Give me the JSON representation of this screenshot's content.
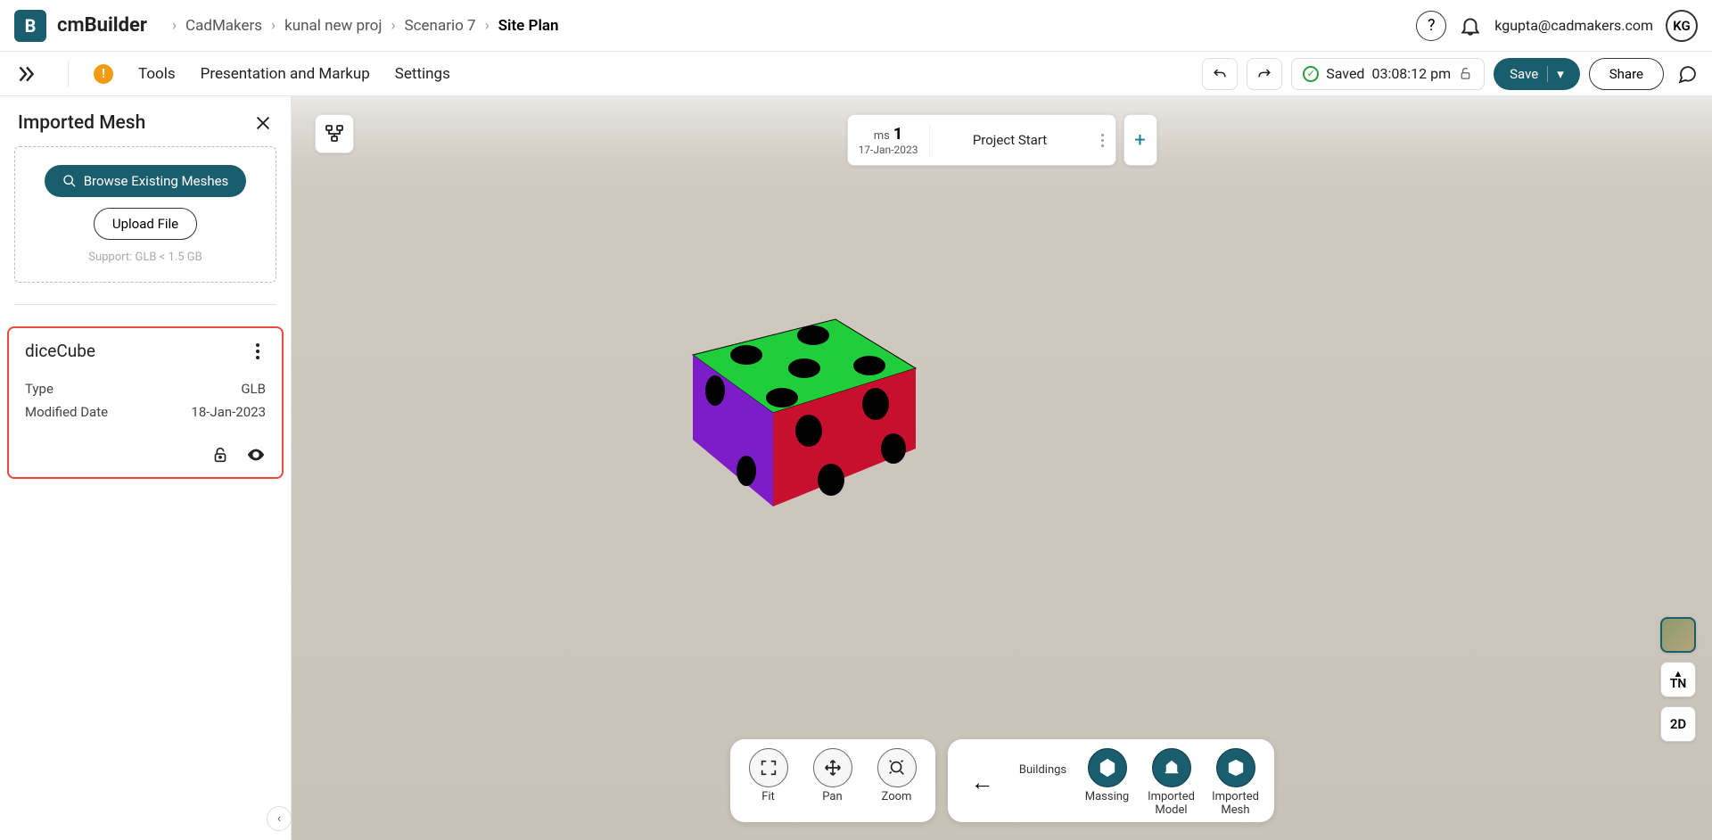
{
  "brand": {
    "prefix": "cm",
    "main": "Builder"
  },
  "breadcrumbs": [
    "CadMakers",
    "kunal new proj",
    "Scenario 7",
    "Site Plan"
  ],
  "user": {
    "email": "kgupta@cadmakers.com",
    "initials": "KG"
  },
  "menu": {
    "tools": "Tools",
    "presentation": "Presentation and Markup",
    "settings": "Settings"
  },
  "actions": {
    "saved_prefix": "Saved",
    "saved_time": "03:08:12 pm",
    "save": "Save",
    "share": "Share"
  },
  "sidebar": {
    "title": "Imported Mesh",
    "browse": "Browse Existing Meshes",
    "upload": "Upload File",
    "support": "Support: GLB < 1.5 GB",
    "mesh": {
      "name": "diceCube",
      "type_label": "Type",
      "type_value": "GLB",
      "date_label": "Modified Date",
      "date_value": "18-Jan-2023"
    }
  },
  "timeline": {
    "ms_label": "ms",
    "ms_num": "1",
    "ms_date": "17-Jan-2023",
    "project_start": "Project Start"
  },
  "toolbar": {
    "fit": "Fit",
    "pan": "Pan",
    "zoom": "Zoom",
    "buildings": "Buildings",
    "massing": "Massing",
    "imp_model": "Imported\nModel",
    "imp_mesh": "Imported\nMesh"
  },
  "rightctrl": {
    "tn": "TN",
    "d2": "2D"
  }
}
